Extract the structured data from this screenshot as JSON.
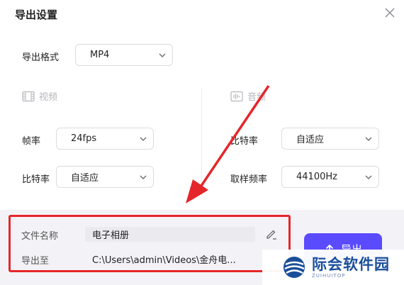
{
  "dialog": {
    "title": "导出设置"
  },
  "format": {
    "label": "导出格式",
    "value": "MP4"
  },
  "video": {
    "section_label": "视频",
    "fps_label": "帧率",
    "fps_value": "24fps",
    "bitrate_label": "比特率",
    "bitrate_value": "自适应"
  },
  "audio": {
    "section_label": "音频",
    "bitrate_label": "比特率",
    "bitrate_value": "自适应",
    "samplerate_label": "取样频率",
    "samplerate_value": "44100Hz"
  },
  "output": {
    "filename_label": "文件名称",
    "filename_value": "电子相册",
    "path_label": "导出至",
    "path_value": "C:\\Users\\admin\\Videos\\金舟电...",
    "export_label": "导出"
  },
  "watermark": {
    "text": "际会软件园",
    "sub": "ZUIHUITOP"
  },
  "colors": {
    "accent": "#5a4bff",
    "annotation": "#e5262a",
    "watermark": "#1a4e9a"
  }
}
